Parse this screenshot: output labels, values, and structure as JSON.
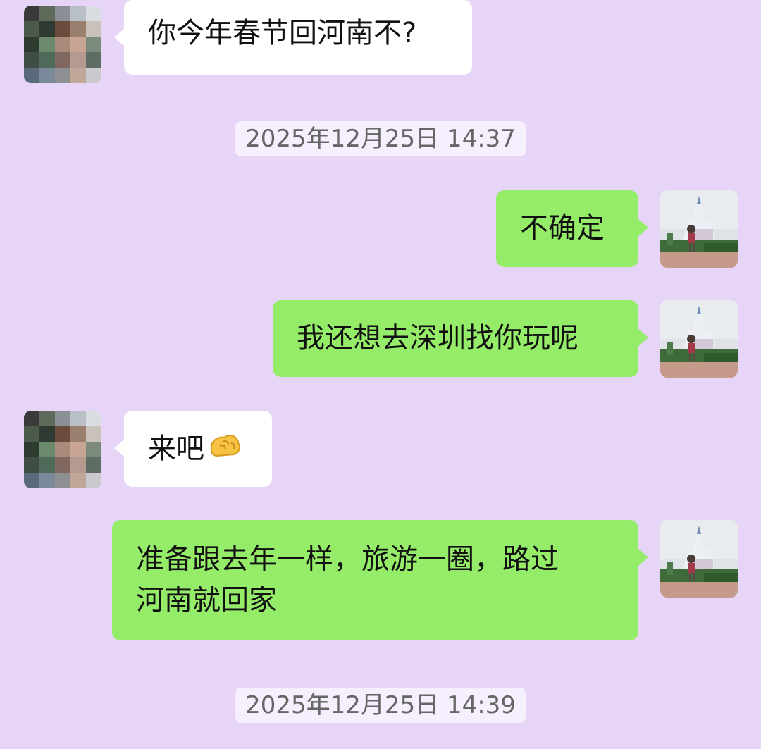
{
  "messages": [
    {
      "side": "in",
      "text": "你今年春节回河南不?"
    },
    {
      "side": "out",
      "text": "不确定"
    },
    {
      "side": "out",
      "text": "我还想去深圳找你玩呢"
    },
    {
      "side": "in",
      "text": "来吧",
      "emoji": "hand-gesture-emoji"
    },
    {
      "side": "out",
      "text_line1": "准备跟去年一样，旅游一圈，路过",
      "text_line2": "河南就回家"
    }
  ],
  "timestamps": [
    "2025年12月25日 14:37",
    "2025年12月25日 14:39"
  ],
  "colors": {
    "background": "#e6d5f7",
    "incoming_bubble": "#ffffff",
    "outgoing_bubble": "#95ec69",
    "timestamp_bg": "#f6effd",
    "timestamp_text": "#666666"
  },
  "icons": [
    "blurred-contact-avatar-icon",
    "castle-photo-avatar-icon",
    "hand-gesture-emoji"
  ]
}
